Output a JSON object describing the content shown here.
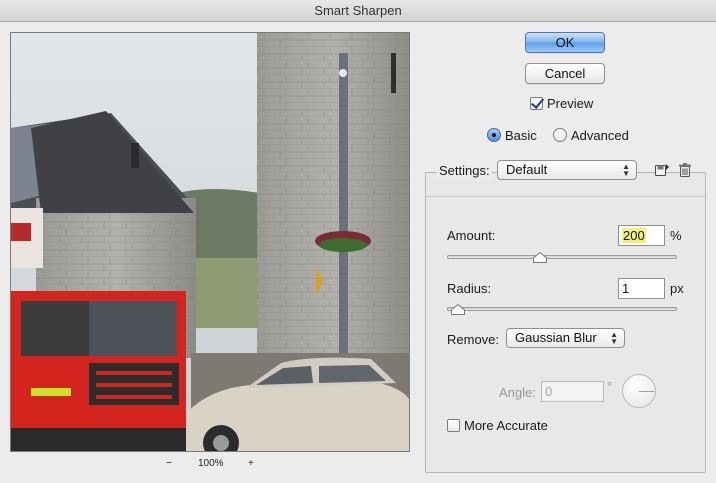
{
  "window": {
    "title": "Smart Sharpen"
  },
  "preview": {
    "zoom_out": "−",
    "zoom_level": "100%",
    "zoom_in": "+"
  },
  "buttons": {
    "ok": "OK",
    "cancel": "Cancel"
  },
  "preview_toggle": {
    "label": "Preview",
    "checked": true
  },
  "mode": {
    "basic": "Basic",
    "advanced": "Advanced",
    "selected": "Basic"
  },
  "settings": {
    "label": "Settings:",
    "value": "Default"
  },
  "amount": {
    "label": "Amount:",
    "value": "200",
    "unit": "%",
    "level": 0.4
  },
  "radius": {
    "label": "Radius:",
    "value": "1",
    "unit": "px",
    "level": 0.02
  },
  "remove": {
    "label": "Remove:",
    "value": "Gaussian Blur"
  },
  "angle": {
    "label": "Angle:",
    "value": "0",
    "unit": "°"
  },
  "more_accurate": {
    "label": "More Accurate",
    "checked": false
  },
  "icons": {
    "save": "save-settings-icon",
    "delete": "trash-icon"
  }
}
